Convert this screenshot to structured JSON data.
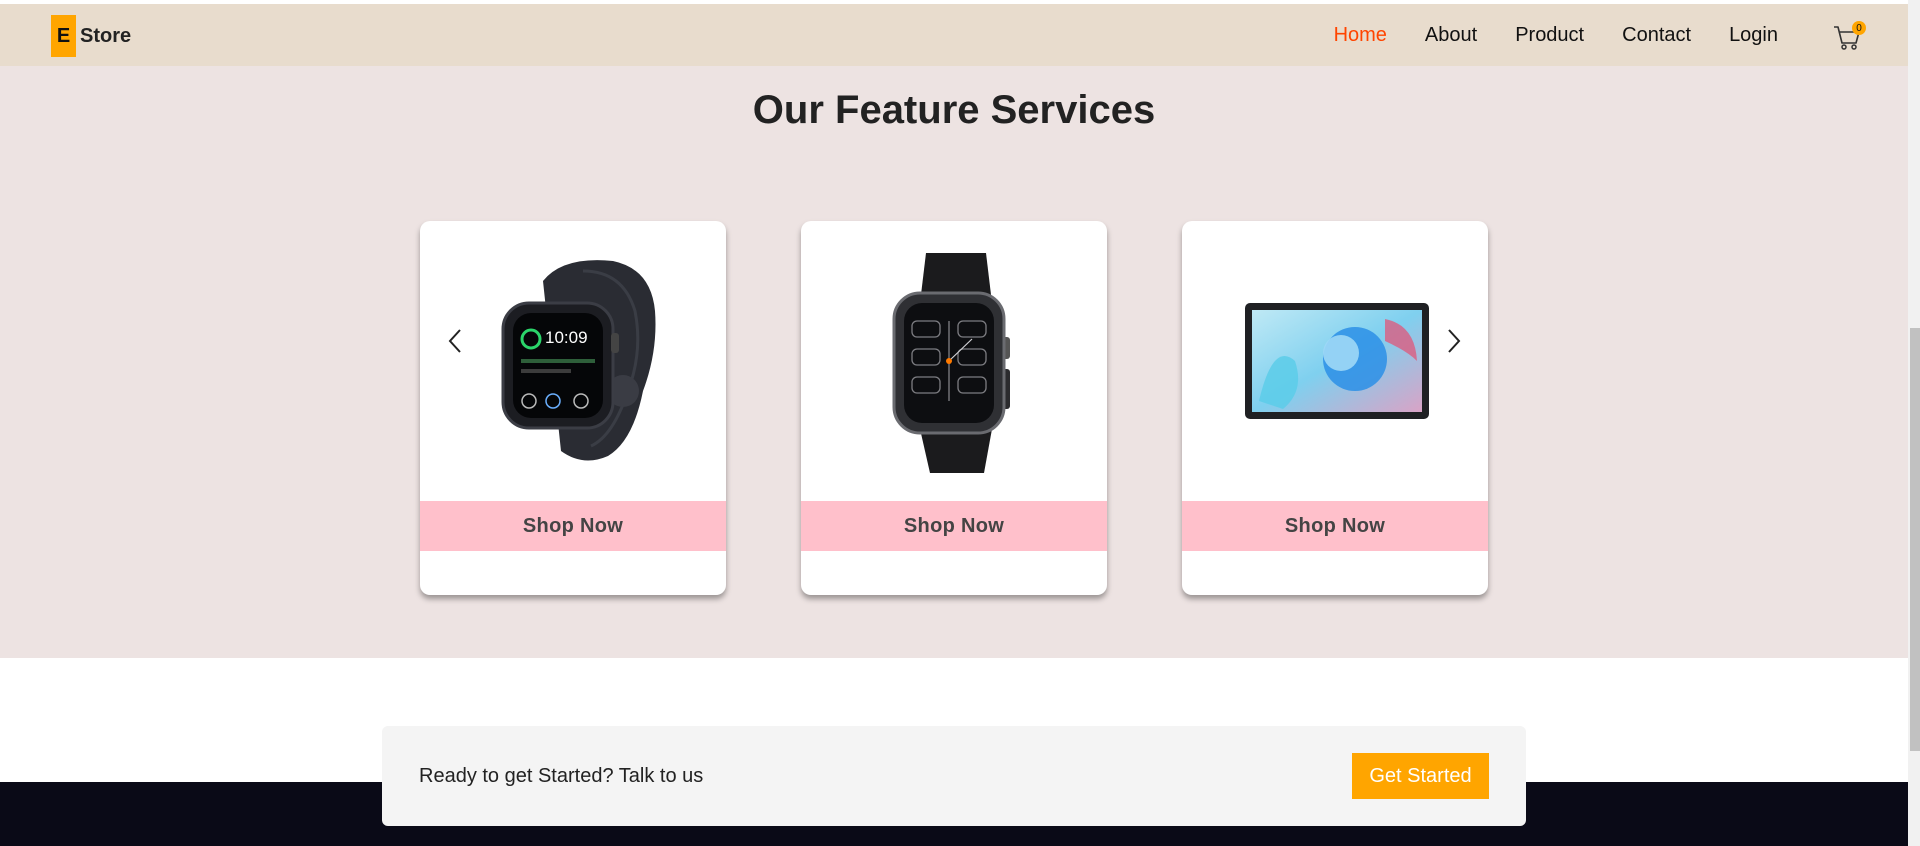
{
  "brand": {
    "mark": "E",
    "name": "Store"
  },
  "nav": {
    "items": [
      {
        "label": "Home",
        "active": true
      },
      {
        "label": "About",
        "active": false
      },
      {
        "label": "Product",
        "active": false
      },
      {
        "label": "Contact",
        "active": false
      },
      {
        "label": "Login",
        "active": false
      }
    ],
    "cart_count": "0"
  },
  "feature": {
    "title": "Our Feature Services",
    "cards": [
      {
        "product": "smartwatch-icon",
        "button": "Shop Now"
      },
      {
        "product": "square-smartwatch-icon",
        "button": "Shop Now"
      },
      {
        "product": "tablet-icon",
        "button": "Shop Now"
      }
    ]
  },
  "cta": {
    "text": "Ready to get Started? Talk to us",
    "button": "Get Started"
  },
  "colors": {
    "accent": "#ffa500",
    "nav_active": "#ff4500",
    "navbar_bg": "#e8dccd",
    "section_bg": "#ede3e2",
    "shop_button": "#ffc0cb",
    "footer": "#0a0a17"
  }
}
